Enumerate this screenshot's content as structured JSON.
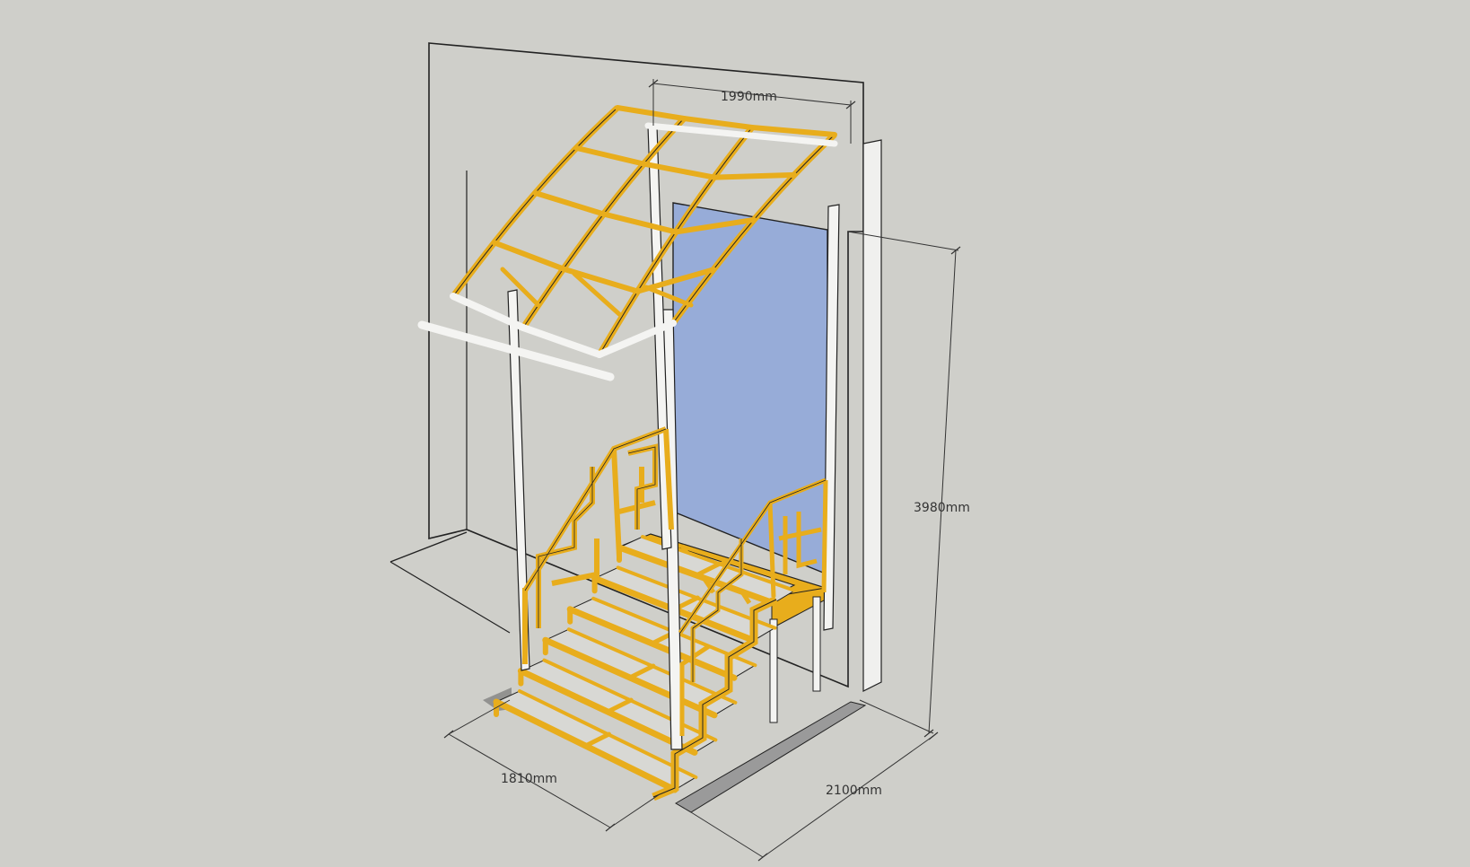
{
  "viewport": {
    "background": "#cfcfca"
  },
  "colors": {
    "steel_yellow": "#e8ad1c",
    "steel_white": "#f4f4f2",
    "outline": "#222222",
    "door_glass": "#97acd8",
    "wall": "#cfcfca",
    "shadow": "#9a9a9a"
  },
  "dimensions": {
    "canopy_width": "1990mm",
    "height": "3980mm",
    "stair_width": "1810mm",
    "depth": "2100mm"
  }
}
